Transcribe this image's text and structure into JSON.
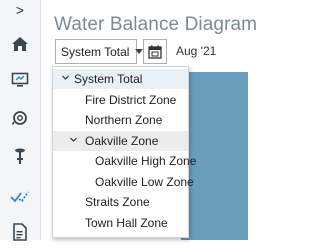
{
  "sidebar": {
    "collapse_glyph": ">",
    "items": [
      {
        "icon": "home-icon"
      },
      {
        "icon": "monitor-icon"
      },
      {
        "icon": "meter-icon"
      },
      {
        "icon": "valve-icon"
      },
      {
        "icon": "analytics-icon"
      },
      {
        "icon": "report-icon"
      }
    ]
  },
  "header": {
    "title": "Water Balance Diagram",
    "zone_select": "System Total",
    "date": "Aug '21"
  },
  "dropdown": {
    "items": [
      {
        "label": "System Total",
        "expanded": true,
        "selected": true
      },
      {
        "label": "Fire District Zone"
      },
      {
        "label": "Northern Zone"
      },
      {
        "label": "Oakville Zone",
        "expanded": true
      },
      {
        "label": "Oakville High Zone"
      },
      {
        "label": "Oakville Low Zone"
      },
      {
        "label": "Straits Zone"
      },
      {
        "label": "Town Hall Zone"
      }
    ]
  },
  "colors": {
    "accent": "#2e86c1",
    "title": "#7d8a93",
    "map": "#6a9cbc"
  }
}
